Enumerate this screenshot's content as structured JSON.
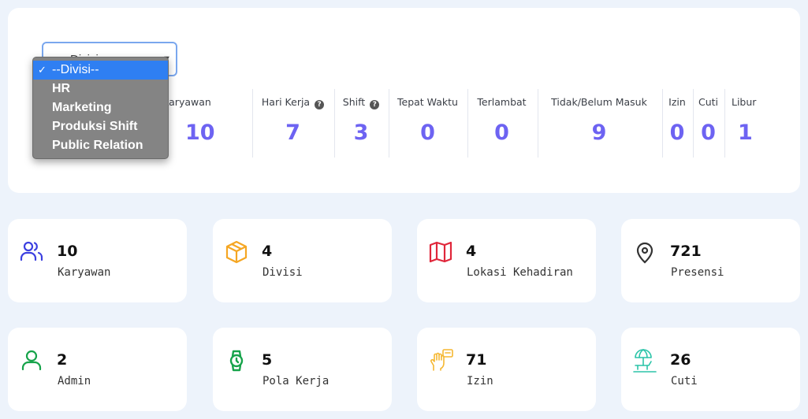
{
  "filter": {
    "placeholder": "Divisi",
    "options": [
      "--Divisi--",
      "HR",
      "Marketing",
      "Produksi Shift",
      "Public Relation"
    ],
    "selected": "--Divisi--"
  },
  "stats": [
    {
      "label": "Total Karyawan",
      "value": "10",
      "help": false
    },
    {
      "label": "Hari Kerja",
      "value": "7",
      "help": true
    },
    {
      "label": "Shift",
      "value": "3",
      "help": true
    },
    {
      "label": "Tepat Waktu",
      "value": "0",
      "help": false
    },
    {
      "label": "Terlambat",
      "value": "0",
      "help": false
    },
    {
      "label": "Tidak/Belum Masuk",
      "value": "9",
      "help": false
    },
    {
      "label": "Izin",
      "value": "0",
      "help": false
    },
    {
      "label": "Cuti",
      "value": "0",
      "help": false
    },
    {
      "label": "Libur",
      "value": "1",
      "help": false
    }
  ],
  "cards": [
    {
      "value": "10",
      "label": "Karyawan",
      "icon": "users-icon",
      "color": "#3b3fe0"
    },
    {
      "value": "4",
      "label": "Divisi",
      "icon": "box-icon",
      "color": "#f5a623"
    },
    {
      "value": "4",
      "label": "Lokasi Kehadiran",
      "icon": "map-icon",
      "color": "#e0263a"
    },
    {
      "value": "721",
      "label": "Presensi",
      "icon": "map-pin-icon",
      "color": "#333333"
    },
    {
      "value": "2",
      "label": "Admin",
      "icon": "user-icon",
      "color": "#16a34a"
    },
    {
      "value": "5",
      "label": "Pola Kerja",
      "icon": "watch-icon",
      "color": "#16a34a"
    },
    {
      "value": "71",
      "label": "Izin",
      "icon": "hand-message-icon",
      "color": "#f5b731"
    },
    {
      "value": "26",
      "label": "Cuti",
      "icon": "beach-icon",
      "color": "#2bc4a8"
    }
  ]
}
